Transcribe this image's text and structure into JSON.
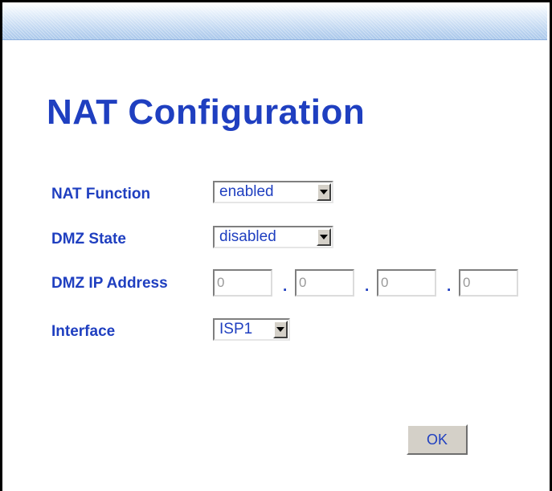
{
  "page": {
    "title": "NAT Configuration",
    "accent_color": "#1f3fc0"
  },
  "form": {
    "nat_function": {
      "label": "NAT Function",
      "value": "enabled"
    },
    "dmz_state": {
      "label": "DMZ State",
      "value": "disabled"
    },
    "dmz_ip": {
      "label": "DMZ IP Address",
      "octets": [
        "0",
        "0",
        "0",
        "0"
      ],
      "separator": "."
    },
    "interface": {
      "label": "Interface",
      "value": "ISP1"
    }
  },
  "actions": {
    "ok_label": "OK"
  }
}
